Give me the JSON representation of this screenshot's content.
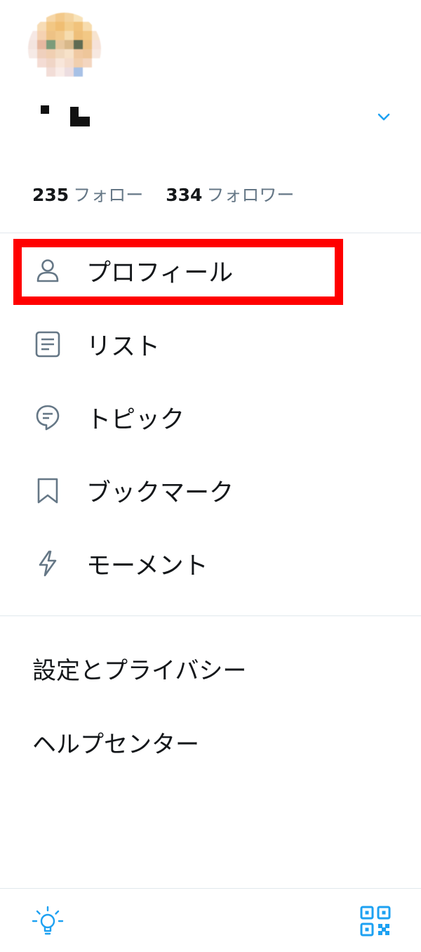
{
  "profile": {
    "avatar_icon": "pixelated-avatar",
    "name_icon": "pixelated-name",
    "switch_icon": "chevron-down-icon"
  },
  "stats": {
    "following_count": "235",
    "following_label": "フォロー",
    "followers_count": "334",
    "followers_label": "フォロワー"
  },
  "menu": [
    {
      "label": "プロフィール",
      "icon": "person-icon"
    },
    {
      "label": "リスト",
      "icon": "list-icon"
    },
    {
      "label": "トピック",
      "icon": "topic-icon"
    },
    {
      "label": "ブックマーク",
      "icon": "bookmark-icon"
    },
    {
      "label": "モーメント",
      "icon": "lightning-icon"
    }
  ],
  "secondary": {
    "settings_label": "設定とプライバシー",
    "help_label": "ヘルプセンター"
  },
  "footer": {
    "left_icon": "lightbulb-icon",
    "right_icon": "qr-code-icon"
  },
  "colors": {
    "accent": "#1da1f2",
    "highlight_border": "#ff0000",
    "muted_text": "#657786",
    "divider": "#e1e8ed"
  }
}
